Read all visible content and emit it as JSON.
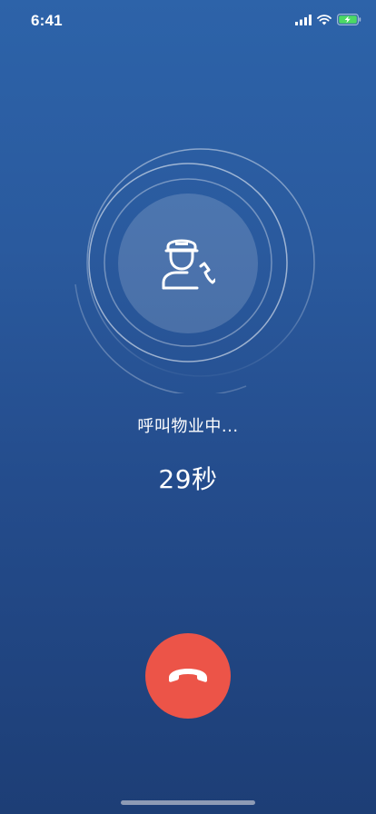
{
  "status_bar": {
    "time": "6:41",
    "signal_icon": "cellular-signal-icon",
    "wifi_icon": "wifi-icon",
    "battery_icon": "battery-charging-icon",
    "battery_color": "#4cd964"
  },
  "call": {
    "avatar_icon": "security-guard-phone-icon",
    "status_text": "呼叫物业中...",
    "elapsed": "29秒"
  },
  "hangup": {
    "icon": "hang-up-phone-icon",
    "color": "#ec5448"
  },
  "colors": {
    "background_top": "#2d63a9",
    "background_bottom": "#1d3e76"
  }
}
